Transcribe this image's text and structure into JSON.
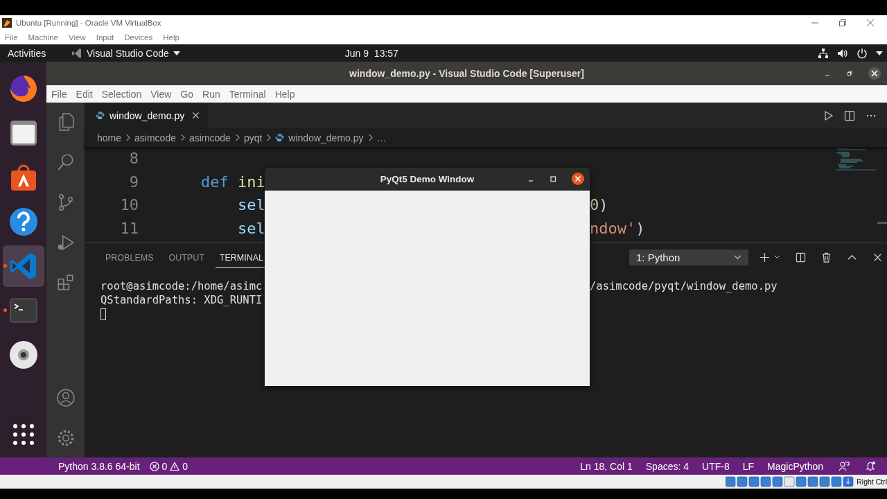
{
  "vm_window": {
    "title": "Ubuntu [Running] - Oracle VM VirtualBox",
    "menu": [
      "File",
      "Machine",
      "View",
      "Input",
      "Devices",
      "Help"
    ]
  },
  "top_bar": {
    "activities": "Activities",
    "app_menu": "Visual Studio Code",
    "clock": "Jun 9  13:57"
  },
  "dock": [
    {
      "kind": "firefox",
      "running": false,
      "selected": false
    },
    {
      "kind": "files",
      "running": false,
      "selected": false
    },
    {
      "kind": "software",
      "running": false,
      "selected": false
    },
    {
      "kind": "help",
      "running": false,
      "selected": false
    },
    {
      "kind": "vscode",
      "running": true,
      "selected": true
    },
    {
      "kind": "terminal",
      "running": true,
      "selected": false
    },
    {
      "kind": "disc",
      "running": false,
      "selected": false
    }
  ],
  "editor_window": {
    "title": "window_demo.py - Visual Studio Code [Superuser]",
    "menu": [
      "File",
      "Edit",
      "Selection",
      "View",
      "Go",
      "Run",
      "Terminal",
      "Help"
    ]
  },
  "tabs": [
    {
      "label": "window_demo.py",
      "selected": true
    }
  ],
  "breadcrumb": [
    "home",
    "asimcode",
    "asimcode",
    "pyqt",
    "window_demo.py",
    "…"
  ],
  "code_lines": [
    {
      "number": "8"
    },
    {
      "number": "9",
      "left": [
        {
          "text": "    def",
          "kind": "keyword"
        },
        {
          "text": " ini",
          "kind": "function"
        }
      ]
    },
    {
      "number": "10",
      "left": [
        {
          "text": "        sel",
          "kind": "variable"
        }
      ],
      "right": [
        {
          "text": "0",
          "kind": "number"
        },
        {
          "text": ")",
          "kind": "plain"
        }
      ]
    },
    {
      "number": "11",
      "left": [
        {
          "text": "        sel",
          "kind": "variable"
        }
      ],
      "right": [
        {
          "text": "ndow'",
          "kind": "string"
        },
        {
          "text": ")",
          "kind": "plain"
        }
      ]
    }
  ],
  "panel": {
    "tabs": [
      {
        "label": "PROBLEMS",
        "selected": false
      },
      {
        "label": "OUTPUT",
        "selected": false
      },
      {
        "label": "TERMINAL",
        "selected": true
      }
    ],
    "terminal_select": "1: Python",
    "terminal_lines": [
      {
        "left": "root@asimcode:/home/asimc",
        "right": "/asimcode/pyqt/window_demo.py"
      },
      {
        "left": "QStandardPaths: XDG_RUNTI"
      }
    ]
  },
  "status_bar": {
    "interpreter": "Python 3.8.6 64-bit",
    "errors": "0",
    "warnings": "0",
    "position": "Ln 18, Col 1",
    "indent": "Spaces: 4",
    "encoding": "UTF-8",
    "eol": "LF",
    "language": "MagicPython"
  },
  "vm_status": {
    "host_key": "Right Ctrl"
  },
  "demo_window": {
    "title": "PyQt5 Demo Window"
  }
}
